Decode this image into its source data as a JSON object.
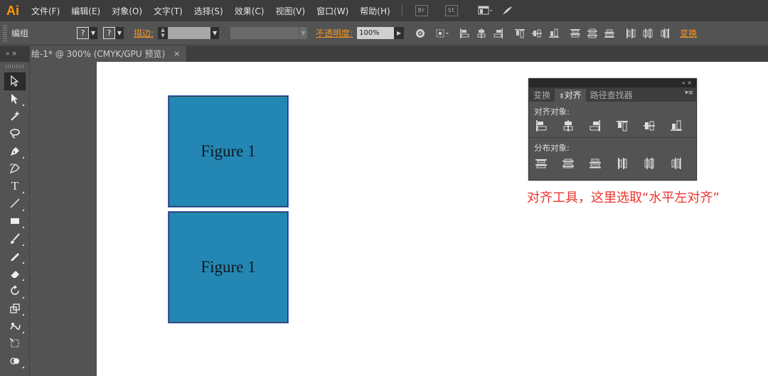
{
  "app": {
    "logo": "Ai"
  },
  "menu": [
    "文件(F)",
    "编辑(E)",
    "对象(O)",
    "文字(T)",
    "选择(S)",
    "效果(C)",
    "视图(V)",
    "窗口(W)",
    "帮助(H)"
  ],
  "menu_buttons": {
    "bridge": "Br",
    "stock": "St"
  },
  "control_bar": {
    "selection": "编组",
    "fill": "?",
    "stroke": "?",
    "stroke_label": "描边:",
    "opacity_label": "不透明度:",
    "opacity_value": "100%",
    "transform_link": "变换"
  },
  "panel_tab": "»  ×",
  "doc_tab": {
    "title": "绘-1* @ 300% (CMYK/GPU 预览)",
    "close": "×"
  },
  "artboard": {
    "figures": [
      {
        "label": "Figure 1"
      },
      {
        "label": "Figure 1"
      }
    ],
    "figure_color": "#2486b3"
  },
  "align_panel": {
    "controls": "«  ×",
    "tabs": [
      "变换",
      "对齐",
      "路径查找器"
    ],
    "active_tab": "对齐",
    "menu_icon": "▾≡",
    "align_objects_label": "对齐对象:",
    "distribute_objects_label": "分布对象:",
    "align_icons": [
      "horizontal-align-left-icon",
      "horizontal-align-center-icon",
      "horizontal-align-right-icon",
      "vertical-align-top-icon",
      "vertical-align-center-icon",
      "vertical-align-bottom-icon"
    ],
    "distribute_icons": [
      "vertical-distribute-top-icon",
      "vertical-distribute-center-icon",
      "vertical-distribute-bottom-icon",
      "horizontal-distribute-left-icon",
      "horizontal-distribute-center-icon",
      "horizontal-distribute-right-icon"
    ]
  },
  "caption": "对齐工具，这里选取“水平左对齐”",
  "accent_color": "#f7941d",
  "caption_color": "#f0322e"
}
